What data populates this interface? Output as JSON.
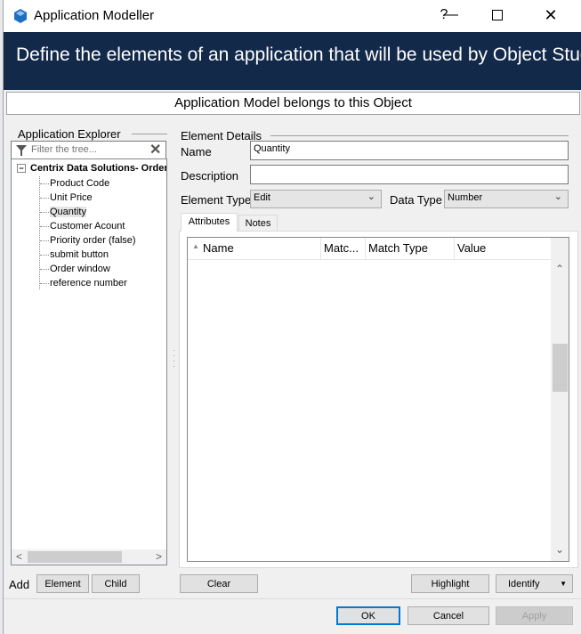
{
  "window": {
    "title": "Application Modeller",
    "help_glyph": "?",
    "minimize_glyph": "—",
    "maximize_glyph": "☐",
    "close_glyph": "✕"
  },
  "banner": {
    "text": "Define the elements of an application that will be used by Object Studio"
  },
  "belongs_bar": {
    "text": "Application Model belongs to this Object"
  },
  "explorer": {
    "title": "Application Explorer",
    "filter_placeholder": "Filter the tree...",
    "filter_clear_glyph": "✕",
    "root": {
      "expander": "−",
      "label": "Centrix Data Solutions-  Order"
    },
    "items": [
      {
        "label": "Product Code",
        "selected": false
      },
      {
        "label": "Unit Price",
        "selected": false
      },
      {
        "label": "Quantity",
        "selected": true
      },
      {
        "label": "Customer Acount",
        "selected": false
      },
      {
        "label": "Priority order (false)",
        "selected": false
      },
      {
        "label": "submit button",
        "selected": false
      },
      {
        "label": "Order window",
        "selected": false
      },
      {
        "label": "reference number",
        "selected": false
      }
    ],
    "scroll_left": "<",
    "scroll_right": ">",
    "add_label": "Add",
    "element_button": "Element",
    "child_button": "Child"
  },
  "details": {
    "title": "Element Details",
    "name_label": "Name",
    "name_value": "Quantity",
    "description_label": "Description",
    "description_value": "",
    "element_type_label": "Element Type",
    "element_type_value": "Edit",
    "data_type_label": "Data Type",
    "data_type_value": "Number",
    "tabs": [
      {
        "label": "Attributes",
        "active": true
      },
      {
        "label": "Notes",
        "active": false
      }
    ],
    "grid_columns": [
      "Name",
      "Matc...",
      "Match Type",
      "Value"
    ],
    "scroll_up": "^",
    "scroll_down": "v",
    "clear_button": "Clear",
    "highlight_button": "Highlight",
    "identify_button": "Identify",
    "identify_dropdown": "▼"
  },
  "footer": {
    "ok_button": "OK",
    "cancel_button": "Cancel",
    "apply_button": "Apply"
  },
  "colors": {
    "banner_bg": "#12294a",
    "banner_text": "#ffffff",
    "default_button_border": "#0078d7"
  }
}
